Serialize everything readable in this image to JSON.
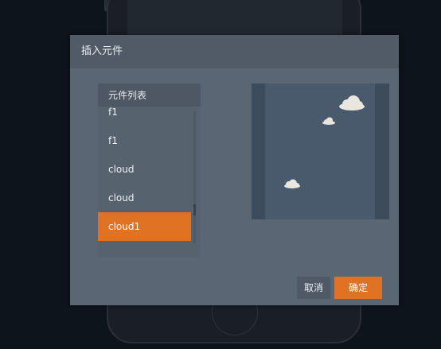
{
  "dialog": {
    "title": "插入元件"
  },
  "component_list": {
    "header": "元件列表",
    "items": [
      {
        "label": "f1",
        "selected": false
      },
      {
        "label": "f1",
        "selected": false
      },
      {
        "label": "cloud",
        "selected": false
      },
      {
        "label": "cloud",
        "selected": false
      },
      {
        "label": "cloud1",
        "selected": true
      }
    ]
  },
  "preview": {
    "icons": [
      "cloud-icon",
      "cloud-icon",
      "cloud-icon"
    ]
  },
  "buttons": {
    "cancel": "取消",
    "ok": "确定"
  },
  "colors": {
    "accent": "#e07224",
    "dialog_bg": "#5a6673",
    "preview_bg": "#495a6c"
  }
}
